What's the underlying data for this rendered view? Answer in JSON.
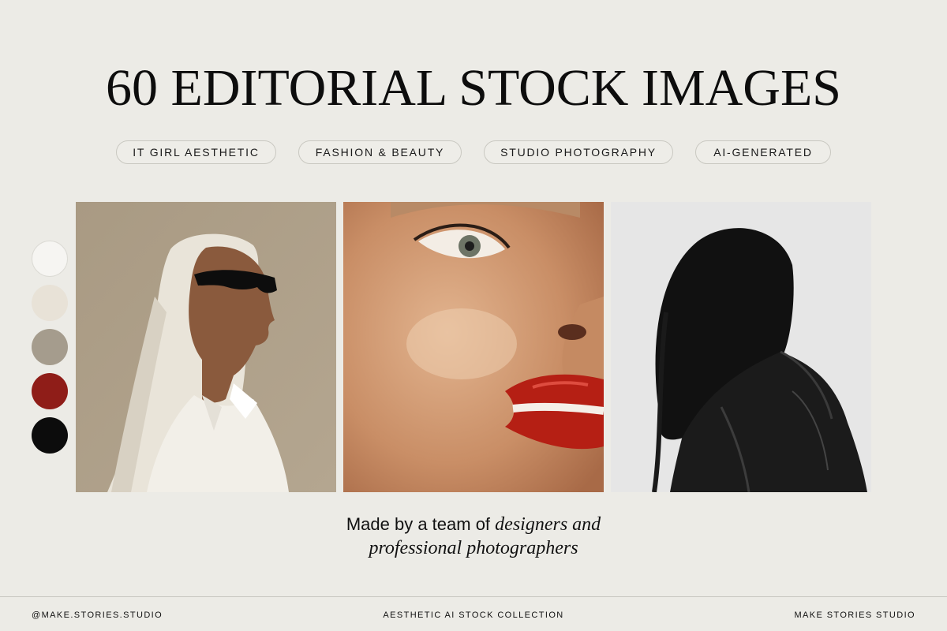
{
  "title": "60 EDITORIAL STOCK IMAGES",
  "tags": [
    "IT GIRL AESTHETIC",
    "FASHION & BEAUTY",
    "STUDIO PHOTOGRAPHY",
    "AI-GENERATED"
  ],
  "palette": [
    "#f6f5f2",
    "#e8e2d7",
    "#a59c8d",
    "#8f1d18",
    "#0c0c0c"
  ],
  "photos": [
    {
      "subject": "woman-white-hair-sunglasses-icon"
    },
    {
      "subject": "closeup-red-lips-face-icon"
    },
    {
      "subject": "black-hair-leather-jacket-icon"
    }
  ],
  "tagline": {
    "line1_plain": "Made by a team of",
    "line1_italic": "designers and",
    "line2_italic": "professional photographers"
  },
  "footer": {
    "left": "@MAKE.STORIES.STUDIO",
    "center": "AESTHETIC AI STOCK COLLECTION",
    "right": "MAKE STORIES STUDIO"
  }
}
